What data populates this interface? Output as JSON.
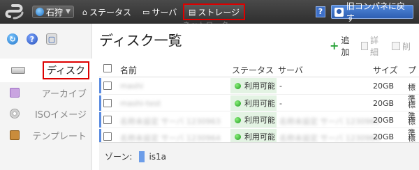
{
  "topbar": {
    "zone": "石狩",
    "nav": {
      "status": "ステータス",
      "server": "サーバ",
      "storage": "ストレージ"
    },
    "ghost": "ネットワーク",
    "help": "?",
    "back": "旧コンパネに戻す"
  },
  "sidebar": {
    "items": [
      {
        "label": "ディスク",
        "icon": "hdd-icon"
      },
      {
        "label": "アーカイブ",
        "icon": "archive-icon"
      },
      {
        "label": "ISOイメージ",
        "icon": "disc-icon"
      },
      {
        "label": "テンプレート",
        "icon": "package-icon"
      }
    ]
  },
  "main": {
    "title": "ディスク一覧",
    "actions": {
      "add": "追加",
      "detail": "詳細",
      "delete": "削"
    },
    "columns": {
      "name": "名前",
      "status": "ステータス",
      "server": "サーバ",
      "size": "サイズ",
      "plan": "プ"
    },
    "rows": [
      {
        "name": "mashi",
        "status": "利用可能",
        "server": "-",
        "size": "20GB",
        "plan": "標準"
      },
      {
        "name": "mashi-test",
        "status": "利用可能",
        "server": "-",
        "size": "20GB",
        "plan": "標準"
      },
      {
        "name": "名称未設定 サーバ 1230963",
        "status": "利用可能",
        "server": "名称未設定 サーバ 1230963",
        "size": "20GB",
        "plan": "標準"
      },
      {
        "name": "名称未設定 サーバ 1230964",
        "status": "利用可能",
        "server": "名称未設定 サーバ 1230964",
        "size": "20GB",
        "plan": "標準"
      }
    ],
    "footer": {
      "zone_label": "ゾーン:",
      "zone_value": "is1a"
    }
  }
}
